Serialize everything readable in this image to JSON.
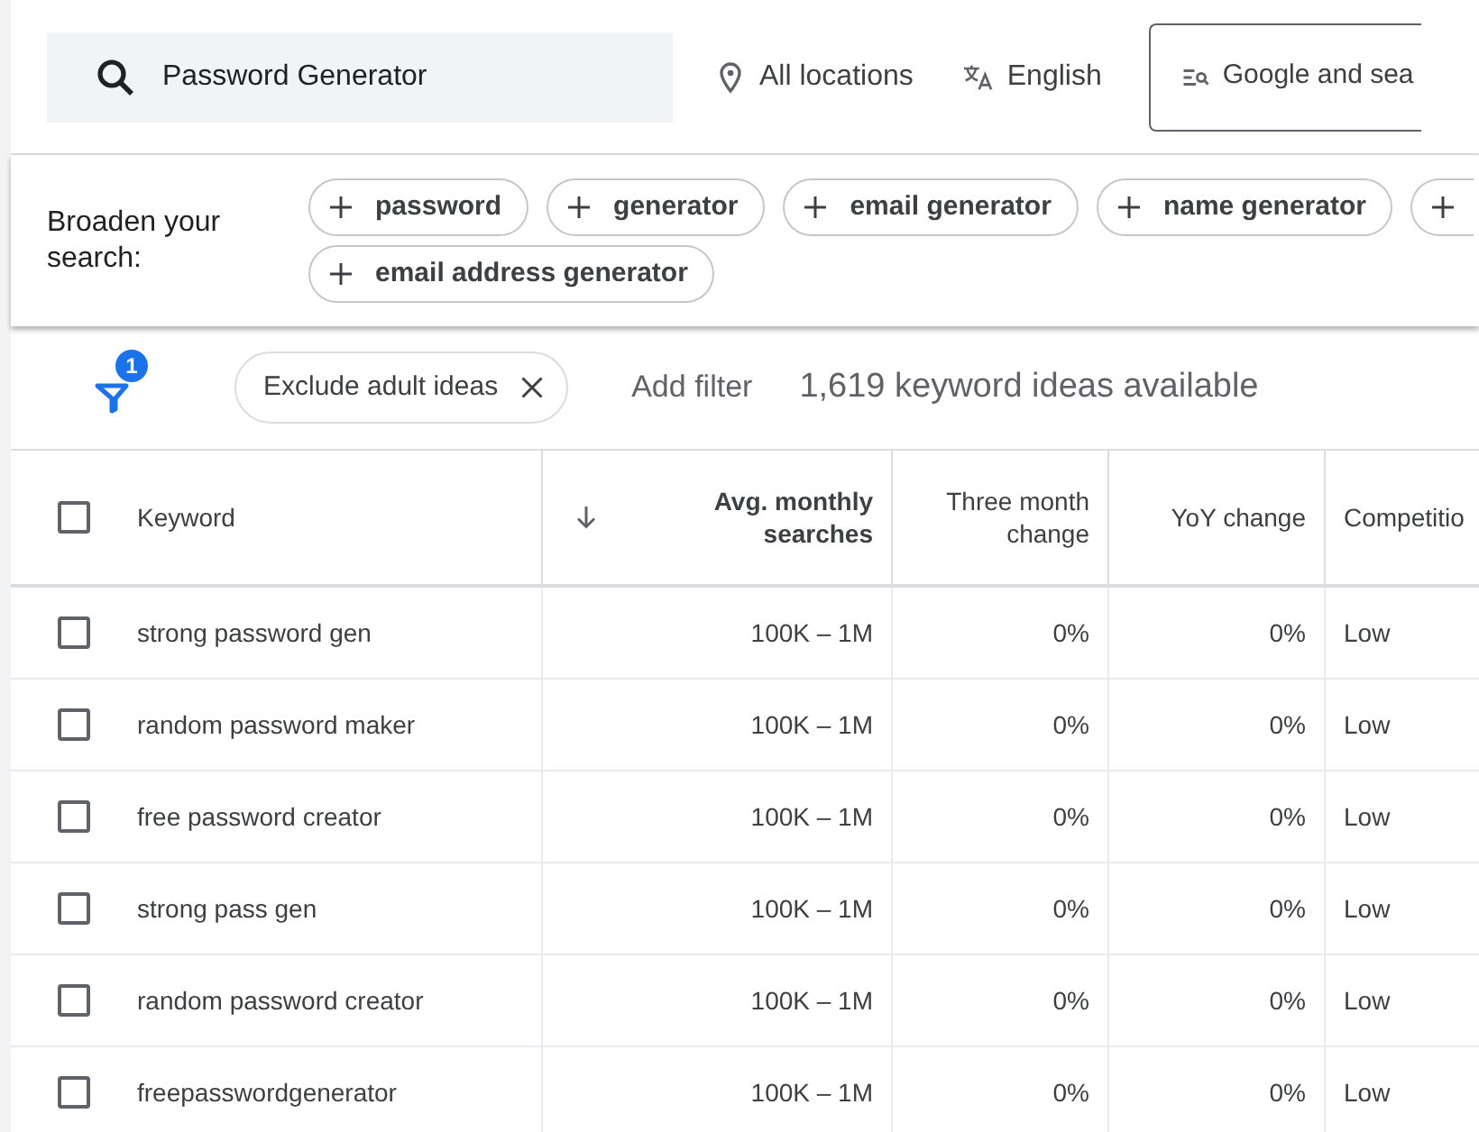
{
  "search": {
    "value": "Password Generator"
  },
  "location": {
    "label": "All locations"
  },
  "language": {
    "label": "English"
  },
  "network": {
    "label": "Google and sea"
  },
  "broaden": {
    "label": "Broaden your search:",
    "chips": [
      {
        "kind": "chip",
        "label": "password"
      },
      {
        "kind": "chip",
        "label": "generator"
      },
      {
        "kind": "chip",
        "label": "email generator"
      },
      {
        "kind": "chip",
        "label": "name generator"
      },
      {
        "kind": "partial"
      },
      {
        "kind": "chip",
        "label": "email address generator"
      }
    ]
  },
  "filters": {
    "count": "1",
    "chips": [
      {
        "label": "Exclude adult ideas"
      }
    ],
    "add_filter": "Add filter",
    "summary": "1,619 keyword ideas available"
  },
  "table": {
    "select_all": {
      "checked": false
    },
    "columns": [
      {
        "label": "Keyword",
        "kind": "text"
      },
      {
        "label": "Avg. monthly searches",
        "kind": "number",
        "sorted": true
      },
      {
        "label": "Three month change",
        "kind": "number"
      },
      {
        "label": "YoY change",
        "kind": "number"
      },
      {
        "label": "Competitio",
        "kind": "text"
      }
    ],
    "rows": [
      {
        "checked": false,
        "cells": [
          "strong password gen",
          "100K – 1M",
          "0%",
          "0%",
          "Low"
        ]
      },
      {
        "checked": false,
        "cells": [
          "random password maker",
          "100K – 1M",
          "0%",
          "0%",
          "Low"
        ]
      },
      {
        "checked": false,
        "cells": [
          "free password creator",
          "100K – 1M",
          "0%",
          "0%",
          "Low"
        ]
      },
      {
        "checked": false,
        "cells": [
          "strong pass gen",
          "100K – 1M",
          "0%",
          "0%",
          "Low"
        ]
      },
      {
        "checked": false,
        "cells": [
          "random password creator",
          "100K – 1M",
          "0%",
          "0%",
          "Low"
        ]
      },
      {
        "checked": false,
        "cells": [
          "freepasswordgenerator",
          "100K – 1M",
          "0%",
          "0%",
          "Low"
        ]
      }
    ]
  }
}
